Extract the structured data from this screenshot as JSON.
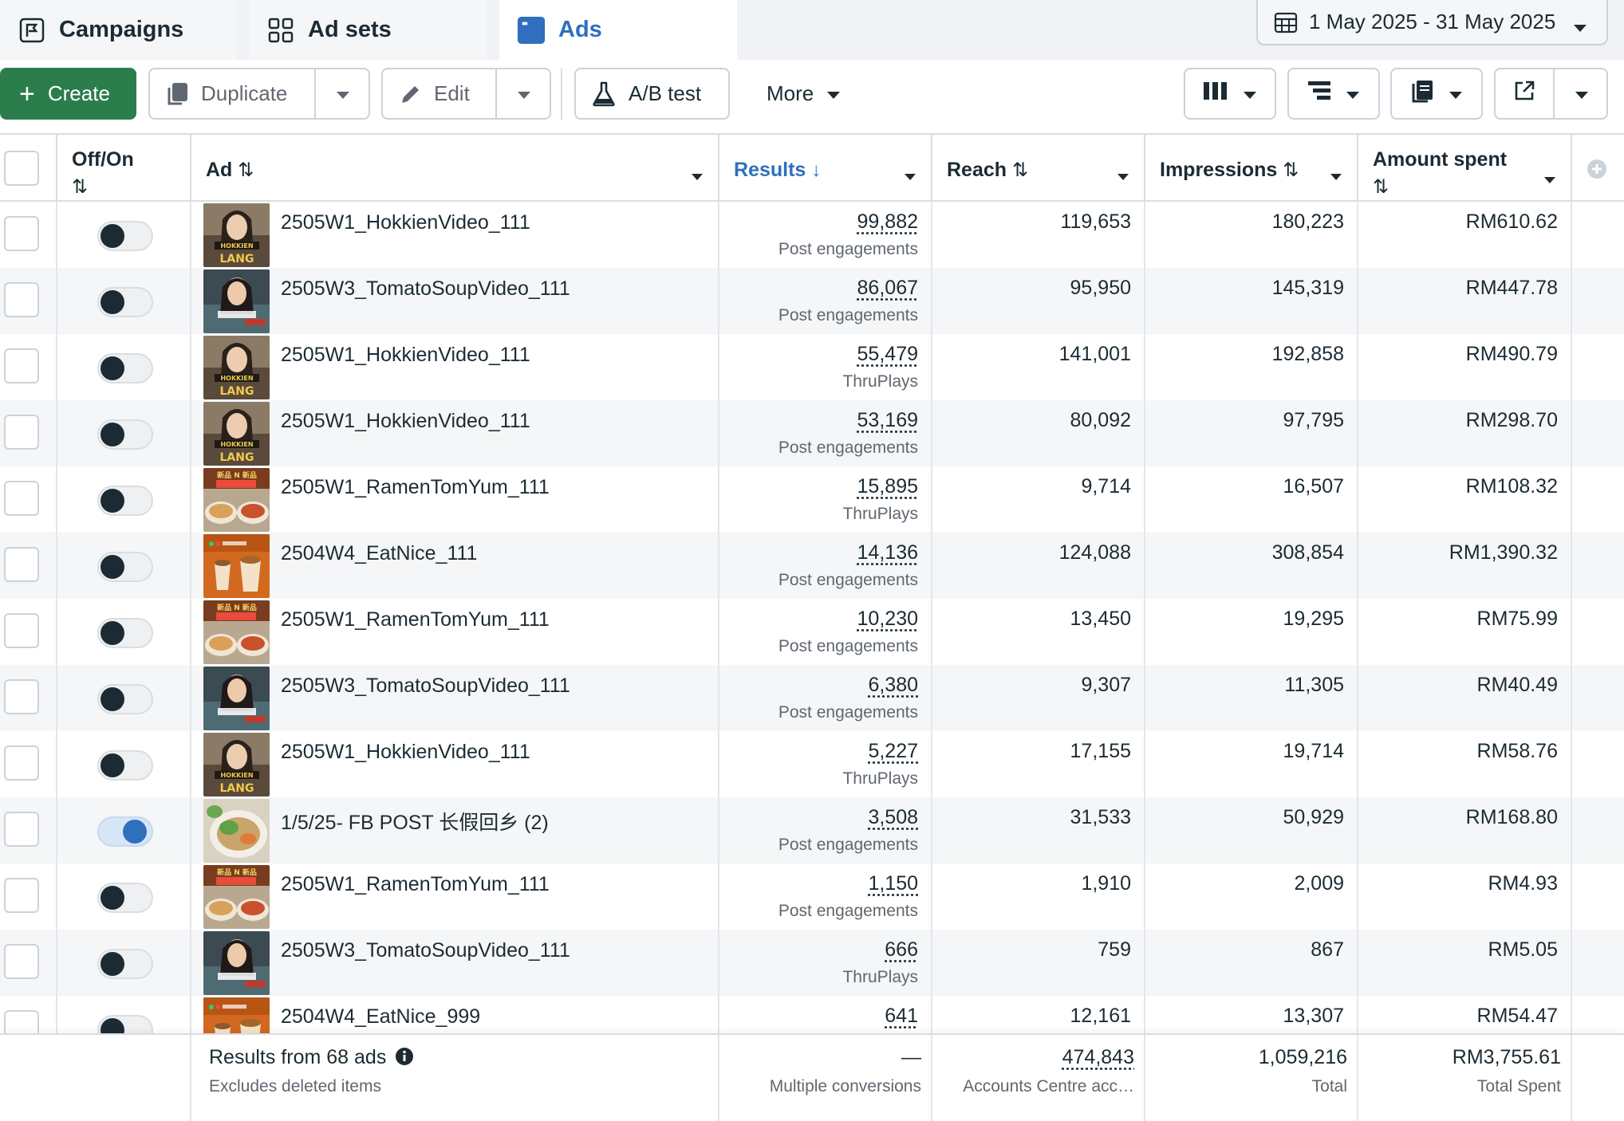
{
  "tabs": [
    {
      "label": "Campaigns",
      "icon": "campaign-flag-icon"
    },
    {
      "label": "Ad sets",
      "icon": "grid-icon"
    },
    {
      "label": "Ads",
      "icon": "ad-window-icon",
      "active": true
    }
  ],
  "date_range": {
    "label": "1 May 2025 - 31 May 2025",
    "icon": "calendar-icon"
  },
  "toolbar": {
    "create_label": "Create",
    "duplicate_label": "Duplicate",
    "edit_label": "Edit",
    "abtest_label": "A/B test",
    "more_label": "More"
  },
  "columns": {
    "toggle": "Off/On",
    "ad": "Ad",
    "results": "Results",
    "reach": "Reach",
    "impressions": "Impressions",
    "amount_spent": "Amount spent"
  },
  "rows": [
    {
      "name": "2505W1_HokkienVideo_111",
      "on": false,
      "thumb": "hokkien",
      "results": "99,882",
      "result_type": "Post engagements",
      "reach": "119,653",
      "impressions": "180,223",
      "spent": "RM610.62"
    },
    {
      "name": "2505W3_TomatoSoupVideo_111",
      "on": false,
      "thumb": "tomato",
      "results": "86,067",
      "result_type": "Post engagements",
      "reach": "95,950",
      "impressions": "145,319",
      "spent": "RM447.78"
    },
    {
      "name": "2505W1_HokkienVideo_111",
      "on": false,
      "thumb": "hokkien",
      "results": "55,479",
      "result_type": "ThruPlays",
      "reach": "141,001",
      "impressions": "192,858",
      "spent": "RM490.79"
    },
    {
      "name": "2505W1_HokkienVideo_111",
      "on": false,
      "thumb": "hokkien",
      "results": "53,169",
      "result_type": "Post engagements",
      "reach": "80,092",
      "impressions": "97,795",
      "spent": "RM298.70"
    },
    {
      "name": "2505W1_RamenTomYum_111",
      "on": false,
      "thumb": "ramen",
      "results": "15,895",
      "result_type": "ThruPlays",
      "reach": "9,714",
      "impressions": "16,507",
      "spent": "RM108.32"
    },
    {
      "name": "2504W4_EatNice_111",
      "on": false,
      "thumb": "eatnice",
      "results": "14,136",
      "result_type": "Post engagements",
      "reach": "124,088",
      "impressions": "308,854",
      "spent": "RM1,390.32"
    },
    {
      "name": "2505W1_RamenTomYum_111",
      "on": false,
      "thumb": "ramen",
      "results": "10,230",
      "result_type": "Post engagements",
      "reach": "13,450",
      "impressions": "19,295",
      "spent": "RM75.99"
    },
    {
      "name": "2505W3_TomatoSoupVideo_111",
      "on": false,
      "thumb": "tomato",
      "results": "6,380",
      "result_type": "Post engagements",
      "reach": "9,307",
      "impressions": "11,305",
      "spent": "RM40.49"
    },
    {
      "name": "2505W1_HokkienVideo_111",
      "on": false,
      "thumb": "hokkien",
      "results": "5,227",
      "result_type": "ThruPlays",
      "reach": "17,155",
      "impressions": "19,714",
      "spent": "RM58.76"
    },
    {
      "name": "1/5/25- FB POST 长假回乡 (2)",
      "on": true,
      "thumb": "fbpost",
      "results": "3,508",
      "result_type": "Post engagements",
      "reach": "31,533",
      "impressions": "50,929",
      "spent": "RM168.80"
    },
    {
      "name": "2505W1_RamenTomYum_111",
      "on": false,
      "thumb": "ramen",
      "results": "1,150",
      "result_type": "Post engagements",
      "reach": "1,910",
      "impressions": "2,009",
      "spent": "RM4.93"
    },
    {
      "name": "2505W3_TomatoSoupVideo_111",
      "on": false,
      "thumb": "tomato",
      "results": "666",
      "result_type": "ThruPlays",
      "reach": "759",
      "impressions": "867",
      "spent": "RM5.05"
    },
    {
      "name": "2504W4_EatNice_999",
      "on": false,
      "thumb": "eatnice",
      "results": "641",
      "result_type": "",
      "reach": "12,161",
      "impressions": "13,307",
      "spent": "RM54.47"
    }
  ],
  "footer": {
    "summary": "Results from 68 ads",
    "summary_note": "Excludes deleted items",
    "results": "—",
    "results_note": "Multiple conversions",
    "reach": "474,843",
    "reach_note": "Accounts Centre acc…",
    "impressions": "1,059,216",
    "impressions_note": "Total",
    "spent": "RM3,755.61",
    "spent_note": "Total Spent"
  },
  "colors": {
    "accent": "#2f6fbd",
    "create": "#2c7d4c",
    "text": "#1c2b33",
    "muted": "#606770"
  }
}
